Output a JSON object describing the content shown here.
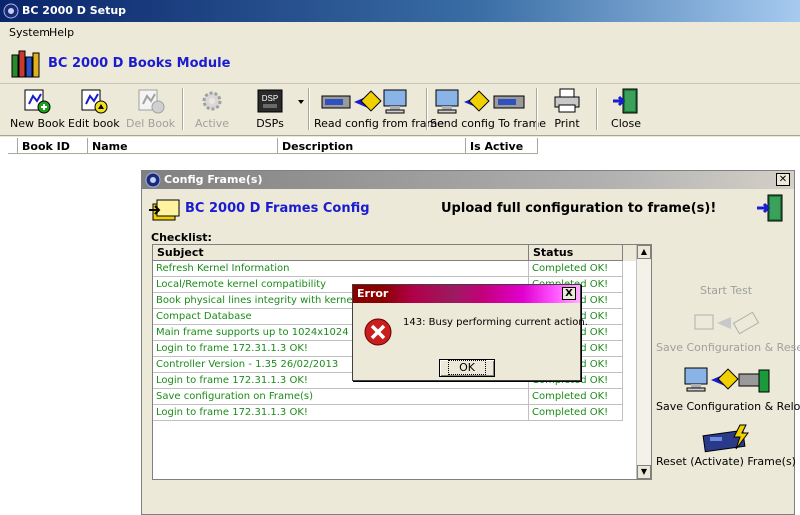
{
  "window": {
    "title": "BC 2000 D Setup"
  },
  "menu": [
    "System",
    "Help"
  ],
  "module": {
    "title": "BC 2000 D Books Module"
  },
  "toolbar": {
    "new_book": "New Book",
    "edit_book": "Edit book",
    "del_book": "Del Book",
    "active": "Active",
    "dsps": "DSPs",
    "dsp_icon_text": "DSP",
    "read_config": "Read config from frame",
    "send_config": "Send config To frame",
    "print": "Print",
    "close": "Close"
  },
  "books_table": {
    "columns": [
      "Book ID",
      "Name",
      "Description",
      "Is Active"
    ]
  },
  "config_window": {
    "title": "Config Frame(s)",
    "heading": "BC 2000 D Frames Config",
    "message": "Upload full configuration to frame(s)!",
    "checklist_label": "Checklist:",
    "columns": [
      "Subject",
      "Status"
    ],
    "rows": [
      {
        "subject": "Refresh Kernel Information",
        "status": "Completed OK!"
      },
      {
        "subject": "Local/Remote kernel compatibility",
        "status": "Completed OK!"
      },
      {
        "subject": "Book physical lines integrity with kernel",
        "status": "Completed OK!"
      },
      {
        "subject": "Compact Database",
        "status": "Completed OK!"
      },
      {
        "subject": "Main frame supports up to 1024x1024 inputs & outputs",
        "status": "Completed OK!"
      },
      {
        "subject": "Login to frame 172.31.1.3 OK!",
        "status": "Completed OK!"
      },
      {
        "subject": "Controller Version - 1.35 26/02/2013",
        "status": "Completed OK!"
      },
      {
        "subject": "Login to frame 172.31.1.3 OK!",
        "status": "Completed OK!"
      },
      {
        "subject": "Save configuration on Frame(s)",
        "status": "Completed OK!"
      },
      {
        "subject": "Login to frame 172.31.1.3 OK!",
        "status": "Completed OK!"
      }
    ],
    "side_buttons": {
      "start_test": "Start Test",
      "save_reset": "Save Configuration & Reset",
      "save_reload": "Save Configuration & Reload",
      "reset_frames": "Reset (Activate) Frame(s)"
    }
  },
  "error_dialog": {
    "title": "Error",
    "message": "143: Busy performing current action.",
    "ok": "OK",
    "close": "X"
  },
  "colors": {
    "accent_blue": "#1b1bd0",
    "status_green": "#1a8c1a",
    "error_red": "#c81e1e"
  }
}
